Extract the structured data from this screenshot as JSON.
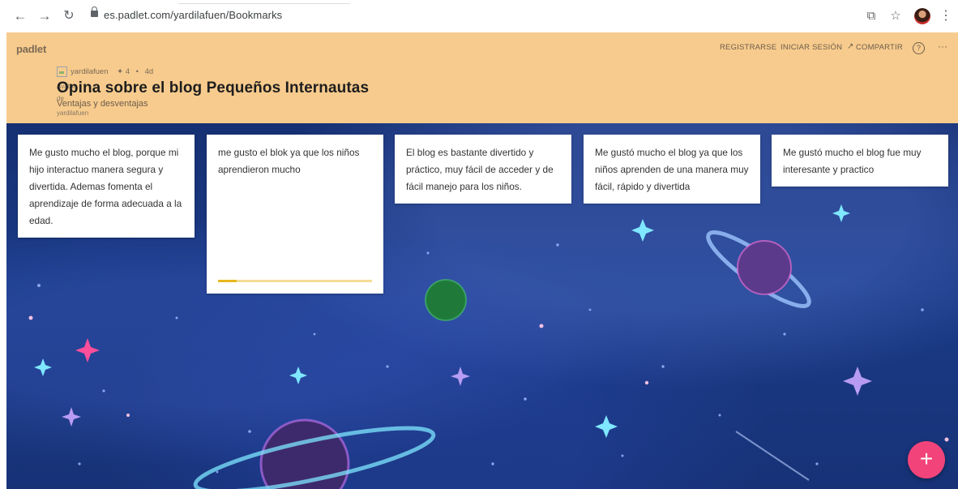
{
  "browser": {
    "url": "es.padlet.com/yardilafuen/Bookmarks",
    "icons": [
      "back-arrow-icon",
      "forward-arrow-icon",
      "reload-icon",
      "lock-icon",
      "cast-icon",
      "star-icon",
      "menu-dots-icon"
    ]
  },
  "header": {
    "brand": "padlet",
    "nav": {
      "register": "REGISTRARSE",
      "login": "INICIAR SESIÓN",
      "share": "COMPARTIR"
    },
    "share_icon": "↗",
    "help_icon": "?",
    "more_icon": "···",
    "author": "yardilafuen",
    "likes": "✦ 4",
    "age": "4d",
    "title": "Opina sobre el blog Pequeños Internautas",
    "subtitle": "Ventajas y desventajas",
    "ghost_alt": "Avatar",
    "ghost_de": "de",
    "ghost_user": "yardilafuen"
  },
  "posts": [
    {
      "text": "Me gusto mucho el blog, porque mi hijo interactuo manera segura y divertida. Ademas fomenta el aprendizaje de forma adecuada a la edad."
    },
    {
      "text": "me gusto el blok ya que los niños aprendieron mucho",
      "progress": 0.12
    },
    {
      "text": "El blog es bastante divertido y práctico, muy fácil de acceder y de fácil manejo para los niños."
    },
    {
      "text": "Me gustó mucho el blog ya que los niños aprenden de una manera muy fácil, rápido y divertida"
    },
    {
      "text": "Me gustó mucho el blog fue muy interesante y practico"
    }
  ],
  "fab": {
    "label": "+"
  },
  "colors": {
    "header": "#f7cb8d",
    "fab": "#f2447a",
    "space": "#1a3a86"
  }
}
